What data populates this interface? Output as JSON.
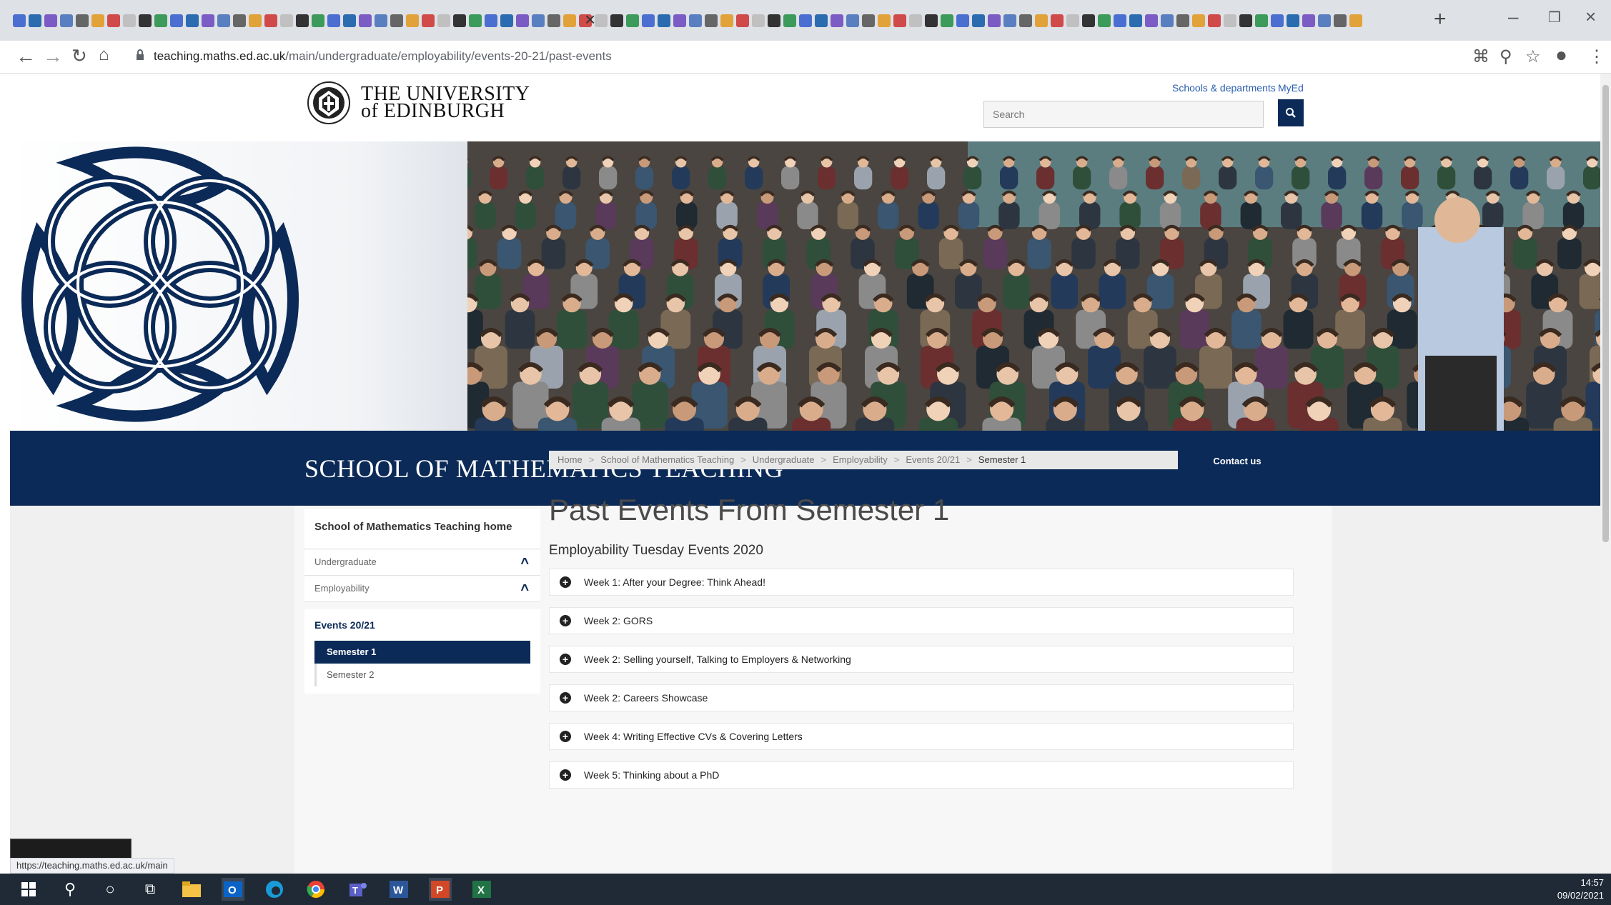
{
  "browser": {
    "url_host": "teaching.maths.ed.ac.uk",
    "url_path": "/main/undergraduate/employability/events-20-21/past-events",
    "status_link": "https://teaching.maths.ed.ac.uk/main"
  },
  "header": {
    "wordmark_line1": "THE UNIVERSITY",
    "wordmark_line2": "of EDINBURGH",
    "link_schools": "Schools & departments",
    "link_myed": "MyEd",
    "search_placeholder": "Search"
  },
  "banner": {
    "title": "SCHOOL OF MATHEMATICS TEACHING"
  },
  "sidebar": {
    "home": "School of Mathematics Teaching home",
    "undergraduate": "Undergraduate",
    "employability": "Employability",
    "section_title": "Events 20/21",
    "items": [
      {
        "label": "Semester 1",
        "active": true
      },
      {
        "label": "Semester 2",
        "active": false
      }
    ]
  },
  "breadcrumb": [
    "Home",
    "School of Mathematics Teaching",
    "Undergraduate",
    "Employability",
    "Events 20/21",
    "Semester 1"
  ],
  "contact_label": "Contact us",
  "main": {
    "title": "Past Events From Semester 1",
    "subtitle": "Employability Tuesday Events 2020",
    "events": [
      "Week 1: After your Degree: Think Ahead!",
      "Week 2: GORS",
      "Week 2: Selling yourself, Talking to Employers & Networking",
      "Week 2: Careers Showcase",
      "Week 4: Writing Effective CVs & Covering Letters",
      "Week 5: Thinking about a PhD"
    ]
  },
  "taskbar": {
    "time": "14:57",
    "date": "09/02/2021"
  },
  "colors": {
    "brand_navy": "#0b2a57",
    "link_blue": "#2a5db0"
  }
}
